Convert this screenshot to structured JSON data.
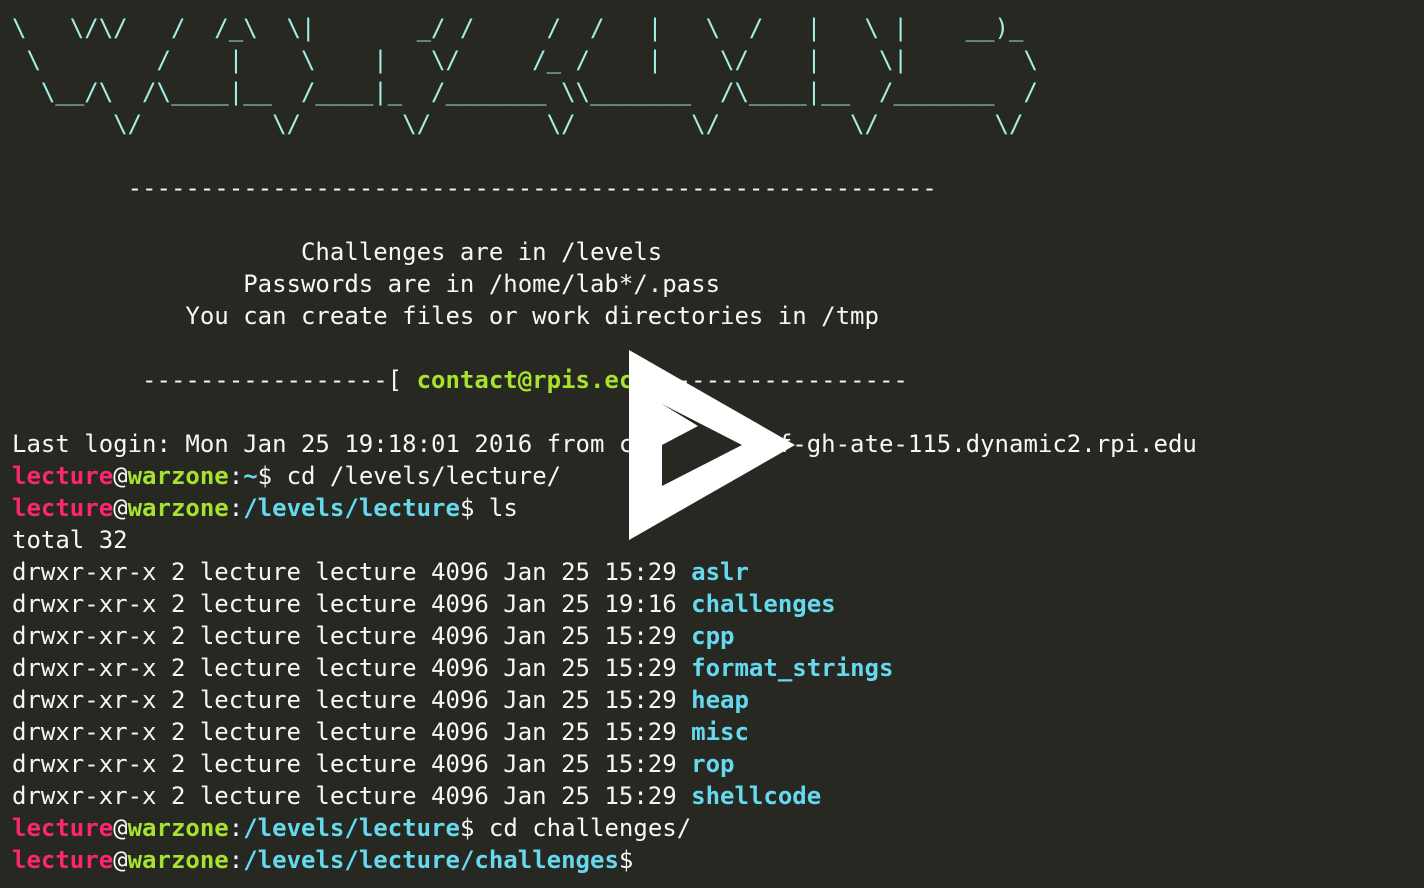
{
  "banner": {
    "ascii_art": [
      "\\   \\/\\/   /  /_\\  \\|       _/ /     /  /   |   \\  /   |   \\ |    __)_",
      " \\        /    |    \\    |   \\/     /_ /    |    \\/    |    \\|        \\",
      "  \\__/\\  /\\____|__  /____|_  /_______ \\\\_______  /\\____|__  /_______  /",
      "       \\/         \\/       \\/        \\/        \\/         \\/        \\/"
    ],
    "divider": "--------------------------------------------------------",
    "info": [
      "                    Challenges are in /levels",
      "                Passwords are in /home/lab*/.pass",
      "            You can create files or work directories in /tmp"
    ],
    "contact_prefix": "         -----------------[ ",
    "contact_email": "contact@rpis.ec",
    "contact_suffix": " ]-----------------"
  },
  "session": {
    "last_login": "Last login: Mon Jan 25 19:18:01 2016 from cpe-ab-cd-ef-gh-ate-115.dynamic2.rpi.edu",
    "user": "lecture",
    "at": "@",
    "host": "warzone",
    "commands": [
      {
        "path": "~",
        "command": " cd /levels/lecture/"
      },
      {
        "path": "/levels/lecture",
        "command": " ls"
      }
    ],
    "total": "total 32",
    "listing": [
      {
        "meta": "drwxr-xr-x 2 lecture lecture 4096 Jan 25 15:29 ",
        "name": "aslr"
      },
      {
        "meta": "drwxr-xr-x 2 lecture lecture 4096 Jan 25 19:16 ",
        "name": "challenges"
      },
      {
        "meta": "drwxr-xr-x 2 lecture lecture 4096 Jan 25 15:29 ",
        "name": "cpp"
      },
      {
        "meta": "drwxr-xr-x 2 lecture lecture 4096 Jan 25 15:29 ",
        "name": "format_strings"
      },
      {
        "meta": "drwxr-xr-x 2 lecture lecture 4096 Jan 25 15:29 ",
        "name": "heap"
      },
      {
        "meta": "drwxr-xr-x 2 lecture lecture 4096 Jan 25 15:29 ",
        "name": "misc"
      },
      {
        "meta": "drwxr-xr-x 2 lecture lecture 4096 Jan 25 15:29 ",
        "name": "rop"
      },
      {
        "meta": "drwxr-xr-x 2 lecture lecture 4096 Jan 25 15:29 ",
        "name": "shellcode"
      }
    ],
    "after": [
      {
        "path": "/levels/lecture",
        "command": " cd challenges/"
      },
      {
        "path": "/levels/lecture/challenges",
        "command": ""
      }
    ]
  },
  "overlay": {
    "icon": "play-icon",
    "color": "#ffffff"
  },
  "colors": {
    "background": "#272822",
    "text": "#f8f8f2",
    "art": "#a1efe4",
    "user": "#f92672",
    "host": "#a6e22e",
    "path": "#66d9ef"
  }
}
